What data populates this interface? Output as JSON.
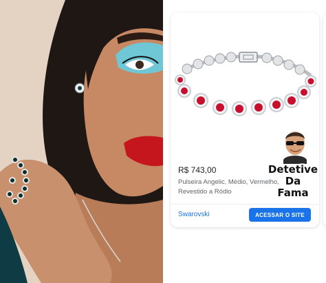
{
  "product": {
    "price": "R$ 743,00",
    "description": "Pulseira Angelic, Médio, Vermelho, Revestido a Ródio",
    "seller": "Swarovski",
    "cta_label": "ACESSAR O SITE",
    "image_icon": "ruby-bracelet-icon"
  },
  "overlay": {
    "line1": "Detetive",
    "line2": "Da",
    "line3": "Fama",
    "avatar_icon": "cartoon-avatar-icon"
  },
  "photo": {
    "subject_icon": "woman-portrait-photo"
  },
  "colors": {
    "accent": "#1a73e8",
    "gem": "#c8102e",
    "eyeshadow": "#6fc7d6",
    "lips": "#c4161c"
  }
}
